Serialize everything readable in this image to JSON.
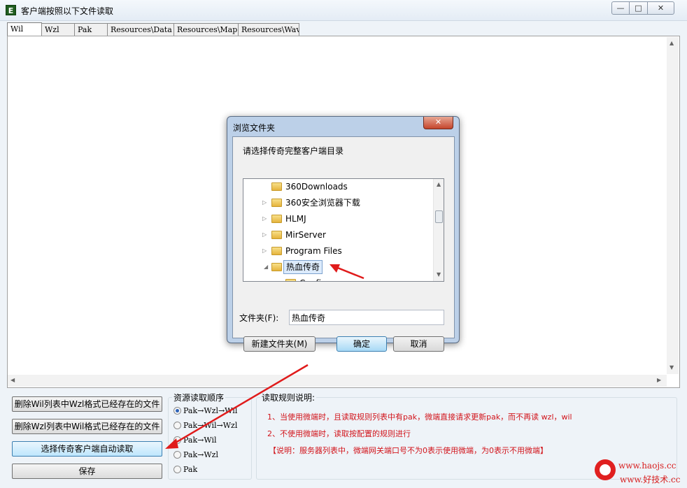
{
  "window": {
    "title": "客户端按照以下文件读取",
    "min_glyph": "—",
    "max_glyph": "□",
    "close_glyph": "✕"
  },
  "tabs": [
    "Wil",
    "Wzl",
    "Pak",
    "Resources\\Data",
    "Resources\\Map",
    "Resources\\Wav"
  ],
  "buttons": {
    "del_wil": "删除Wil列表中Wzl格式已经存在的文件",
    "del_wzl": "删除Wzl列表中Wil格式已经存在的文件",
    "select_client": "选择传奇客户端自动读取",
    "save": "保存"
  },
  "order_group": {
    "title": "资源读取顺序",
    "options": [
      "Pak→Wzl→Wil",
      "Pak→Wil→Wzl",
      "Pak→Wil",
      "Pak→Wzl",
      "Pak"
    ],
    "selected_index": 0
  },
  "rules_group": {
    "title": "读取规则说明:",
    "lines": [
      "1、当使用微端时，且读取规则列表中有pak，微端直接请求更新pak，而不再读 wzl，wil",
      "2、不使用微端时，读取按配置的规则进行",
      "【说明：服务器列表中，微端网关端口号不为0表示使用微端，为0表示不用微端】"
    ]
  },
  "dialog": {
    "title": "浏览文件夹",
    "close_glyph": "✕",
    "prompt": "请选择传奇完整客户端目录",
    "tree": [
      {
        "label": "360Downloads",
        "expander": ""
      },
      {
        "label": "360安全浏览器下载",
        "expander": "▷"
      },
      {
        "label": "HLMJ",
        "expander": "▷"
      },
      {
        "label": "MirServer",
        "expander": "▷"
      },
      {
        "label": "Program Files",
        "expander": "▷"
      },
      {
        "label": "热血传奇",
        "expander": "◢"
      },
      {
        "label": "Config",
        "expander": ""
      }
    ],
    "folder_label": "文件夹(F):",
    "folder_value": "热血传奇",
    "new_folder": "新建文件夹(M)",
    "ok": "确定",
    "cancel": "取消"
  },
  "watermark": {
    "line1": "www.haojs.cc",
    "line2": "www.好技术.cc"
  },
  "colors": {
    "rule_text": "#d2141b",
    "arrow": "#e01b1b"
  }
}
